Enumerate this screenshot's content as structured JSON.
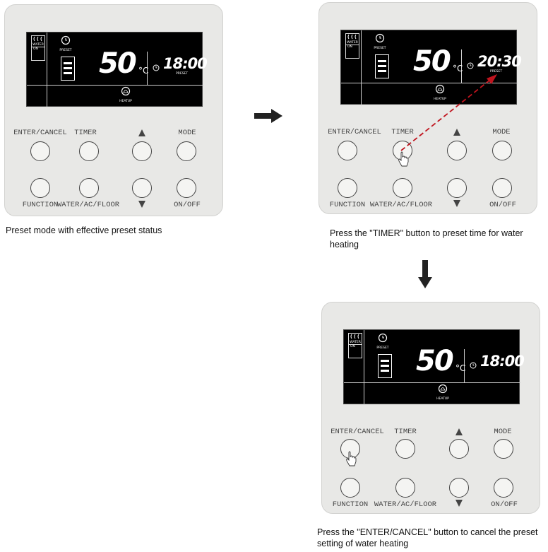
{
  "panels": [
    {
      "water": "WATER",
      "water_on": "ON",
      "preset_label": "PRESET",
      "heatup_label": "HEATUP",
      "temperature": "50",
      "unit": "°C",
      "time": "18:00",
      "time_sub": "PRESET",
      "buttons": {
        "enter_cancel": "ENTER/CANCEL",
        "timer": "TIMER",
        "mode": "MODE",
        "function": "FUNCTION",
        "water_ac_floor": "WATER/AC/FLOOR",
        "on_off": "ON/OFF"
      },
      "caption": "Preset mode with effective preset status"
    },
    {
      "water": "WATER",
      "water_on": "ON",
      "preset_label": "PRESET",
      "heatup_label": "HEATUP",
      "temperature": "50",
      "unit": "°C",
      "time": "20:30",
      "time_sub": "PRESET",
      "buttons": {
        "enter_cancel": "ENTER/CANCEL",
        "timer": "TIMER",
        "mode": "MODE",
        "function": "FUNCTION",
        "water_ac_floor": "WATER/AC/FLOOR",
        "on_off": "ON/OFF"
      },
      "caption": "Press the \"TIMER\" button to preset time for water heating"
    },
    {
      "water": "WATER",
      "water_on": "ON",
      "preset_label": "PRESET",
      "heatup_label": "HEATUP",
      "temperature": "50",
      "unit": "°C",
      "time": "18:00",
      "time_sub": "",
      "buttons": {
        "enter_cancel": "ENTER/CANCEL",
        "timer": "TIMER",
        "mode": "MODE",
        "function": "FUNCTION",
        "water_ac_floor": "WATER/AC/FLOOR",
        "on_off": "ON/OFF"
      },
      "caption": "Press the \"ENTER/CANCEL\" button to cancel the preset setting of water heating"
    }
  ],
  "colors": {
    "panel": "#e8e8e6",
    "lcd": "#000000",
    "arrow": "#222222",
    "dashed_arrow": "#c0141e"
  },
  "icons": {
    "flow_arrow_right": "right-arrow-icon",
    "flow_arrow_down": "down-arrow-icon",
    "finger": "pointing-hand-icon"
  }
}
